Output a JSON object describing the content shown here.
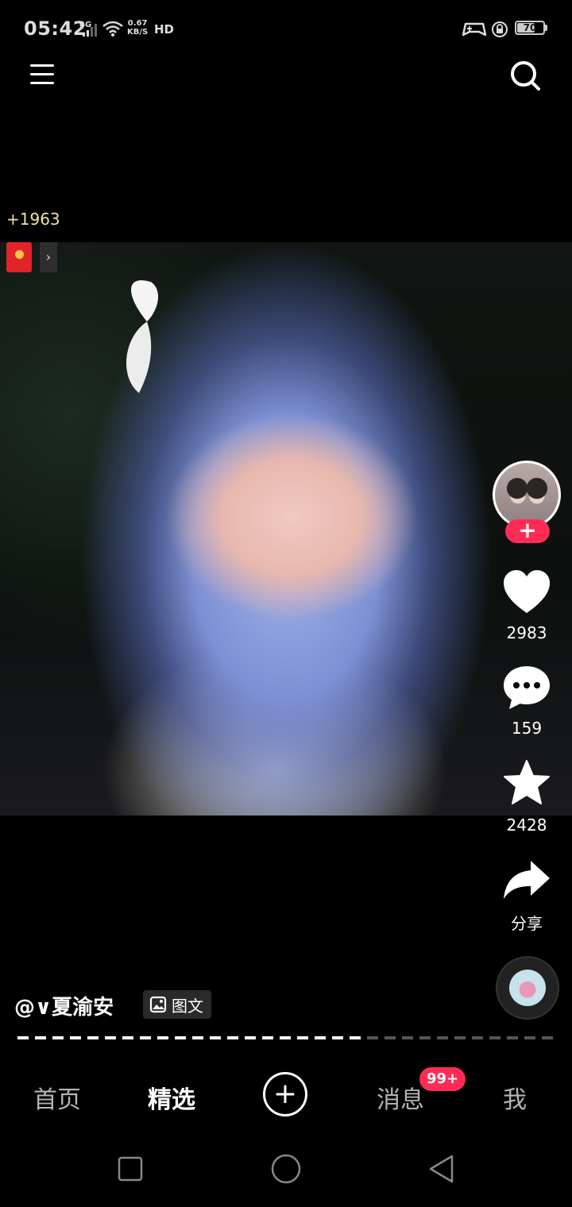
{
  "status_bar": {
    "time": "05:42",
    "network": "4G",
    "speed_value": "0.67",
    "speed_unit": "KB/S",
    "hd": "HD",
    "battery": "70",
    "battery_level": 0.7
  },
  "coins": "+1963",
  "post": {
    "author": "@∨夏渝安",
    "type_tag": "图文",
    "progress_fraction": 0.64
  },
  "actions": {
    "likes": "2983",
    "comments": "159",
    "favorites": "2428",
    "share_label": "分享"
  },
  "tabs": [
    {
      "label": "首页",
      "active": false
    },
    {
      "label": "精选",
      "active": true
    },
    {
      "label": "消息",
      "active": false
    },
    {
      "label": "我",
      "active": false
    }
  ],
  "messages_badge": "99+",
  "colors": {
    "accent": "#fe2c55",
    "background": "#000000",
    "coin_text": "#f3e3a0"
  }
}
